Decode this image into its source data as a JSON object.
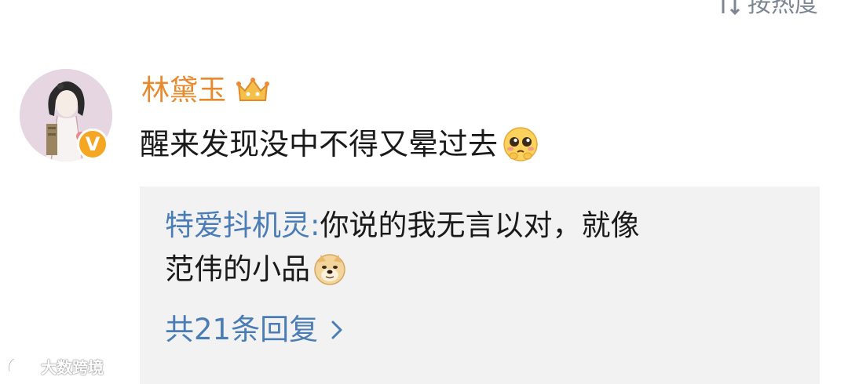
{
  "header": {
    "sort_label": "按热度"
  },
  "comment": {
    "username": "林黛玉",
    "text": "醒来发现没中不得又晕过去",
    "badge_text": "V"
  },
  "reply": {
    "username": "特爱抖机灵",
    "colon": ":",
    "text_line1": " 你说的我无言以对，就像",
    "text_line2": "范伟的小品",
    "more_label": "共21条回复"
  },
  "watermark": {
    "text": "大数跨境"
  },
  "colors": {
    "username": "#e8892b",
    "link": "#4a7cb5",
    "sort": "#7c8793",
    "reply_bg": "#f2f2f2",
    "badge": "#f5a623"
  }
}
